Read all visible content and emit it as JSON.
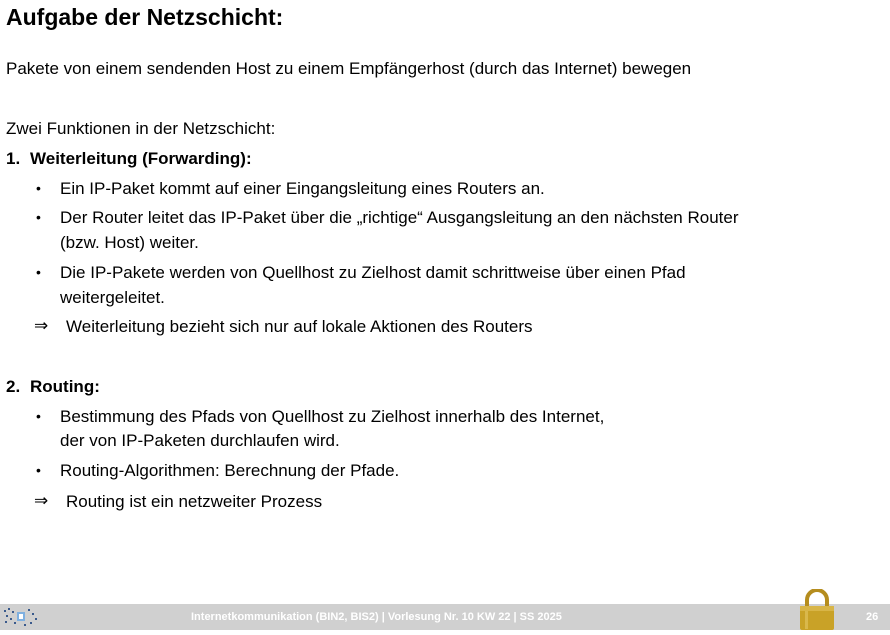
{
  "slide": {
    "title": "Aufgabe der Netzschicht:",
    "intro": "Pakete von einem sendenden Host zu einem Empfängerhost (durch das Internet) bewegen",
    "two_functions": "Zwei Funktionen in der Netzschicht:",
    "section1": {
      "number": "1.",
      "heading": "Weiterleitung (Forwarding):",
      "bullet_symbol": "•",
      "bullet1": "Ein IP-Paket kommt auf einer Eingangsleitung eines Routers an.",
      "bullet2_line1": "Der Router leitet das IP-Paket über die „richtige“ Ausgangsleitung an den nächsten Router",
      "bullet2_line2": "(bzw. Host) weiter.",
      "bullet3_line1": "Die IP-Pakete werden von Quellhost zu Zielhost damit schrittweise über einen Pfad",
      "bullet3_line2": "weitergeleitet.",
      "arrow": "⇒",
      "conclusion": "Weiterleitung bezieht sich nur auf lokale Aktionen des Routers"
    },
    "section2": {
      "number": "2.",
      "heading": "Routing:",
      "bullet1_line1": "Bestimmung des Pfads von Quellhost zu Zielhost innerhalb des Internet,",
      "bullet1_line2": "der von IP-Paketen durchlaufen wird.",
      "bullet2": "Routing-Algorithmen: Berechnung der Pfade.",
      "arrow": "⇒",
      "conclusion": "Routing ist ein netzweiter Prozess"
    }
  },
  "footer": {
    "text": "Internetkommunikation (BIN2, BIS2) | Vorlesung Nr. 10 KW 22 | SS 2025",
    "page_number": "26",
    "logo_icon": "university-logo-icon",
    "lock_icon": "padlock-icon"
  },
  "colors": {
    "footer_bg": "#d0d0d0",
    "footer_text": "#ffffff",
    "lock_gold": "#c9a227"
  }
}
